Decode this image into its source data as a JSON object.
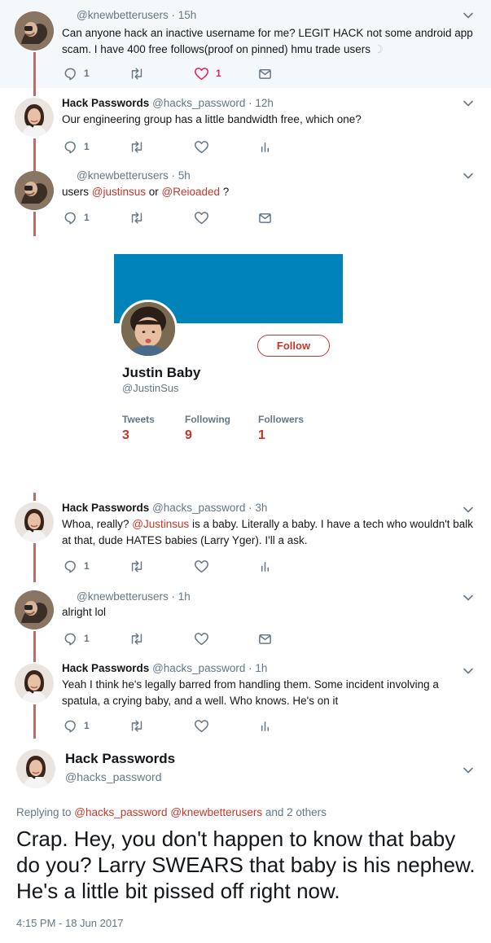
{
  "tweets": [
    {
      "author_name": "",
      "handle": "@knewbetterusers",
      "time": "15h",
      "text": "Can anyone hack an inactive username for me? LEGIT HACK not some android app scam. I have 400 free follows(proof on pinned) hmu trade users",
      "reply_count": "1",
      "retweet_count": "",
      "like_count": "1"
    },
    {
      "author_name": "Hack Passwords",
      "handle": "@hacks_password",
      "time": "12h",
      "text": "Our engineering group has a little bandwidth free, which one?",
      "reply_count": "1",
      "retweet_count": "",
      "like_count": ""
    },
    {
      "author_name": "",
      "handle": "@knewbetterusers",
      "time": "5h",
      "text_prefix": "users ",
      "mention1": "@justinsus",
      "text_mid": " or ",
      "mention2": "@Reioaded",
      "text_suffix": " ?",
      "reply_count": "1"
    },
    {
      "author_name": "Hack Passwords",
      "handle": "@hacks_password",
      "time": "3h",
      "text_prefix": "Whoa, really? ",
      "mention1": "@Justinsus",
      "text_suffix": " is a baby. Literally a baby. I have a tech who wouldn't balk at that, dude HATES babies (Larry Yger). I'll a ask.",
      "reply_count": "1"
    },
    {
      "author_name": "",
      "handle": "@knewbetterusers",
      "time": "1h",
      "text": "alright lol",
      "reply_count": "1"
    },
    {
      "author_name": "Hack Passwords",
      "handle": "@hacks_password",
      "time": "1h",
      "text": "Yeah I think he's legally barred from handling them. Some incident involving a spatula, a crying baby, and a well. Who knows. He's on it",
      "reply_count": "1"
    }
  ],
  "card": {
    "name": "Justin Baby",
    "handle": "@JustinSus",
    "follow_label": "Follow",
    "tweets_label": "Tweets",
    "tweets_value": "3",
    "following_label": "Following",
    "following_value": "9",
    "followers_label": "Followers",
    "followers_value": "1"
  },
  "main_tweet": {
    "name": "Hack Passwords",
    "handle": "@hacks_password",
    "replying_prefix": "Replying to ",
    "replying_mention1": "@hacks_password",
    "replying_mention2": "@knewbetterusers",
    "replying_suffix": " and 2 others",
    "text": "Crap. Hey, you don't happen to know that baby do you? Larry SWEARS that baby is his nephew. He's a little bit pissed off right now.",
    "timestamp": "4:15 PM - 18 Jun 2017"
  },
  "colors": {
    "accent": "#c0392b",
    "banner": "#0083b8",
    "thread_line": "#c06a6a",
    "muted": "#657786",
    "like_active": "#e0245e"
  },
  "icons": [
    "reply-icon",
    "retweet-icon",
    "like-icon",
    "dm-icon",
    "analytics-icon",
    "chevron-down-icon"
  ]
}
